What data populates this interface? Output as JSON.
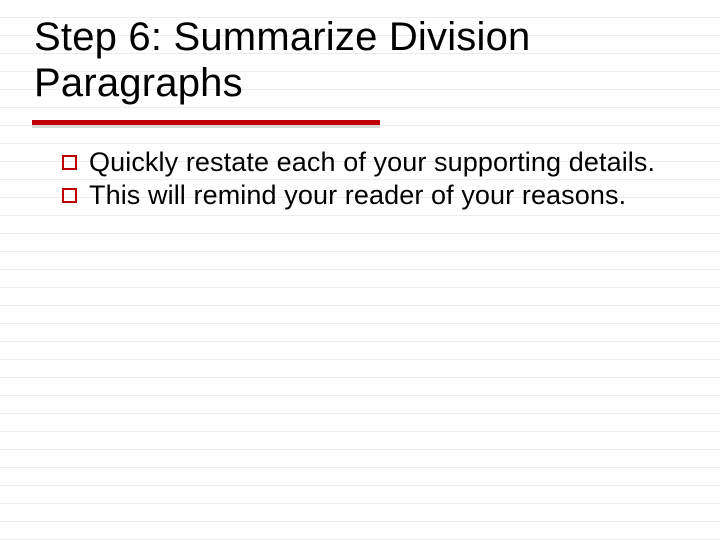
{
  "slide": {
    "title": "Step 6: Summarize Division Paragraphs",
    "bullets": [
      "Quickly restate each of your supporting details.",
      "This will remind your reader of your reasons."
    ],
    "accent_color": "#c00000"
  }
}
